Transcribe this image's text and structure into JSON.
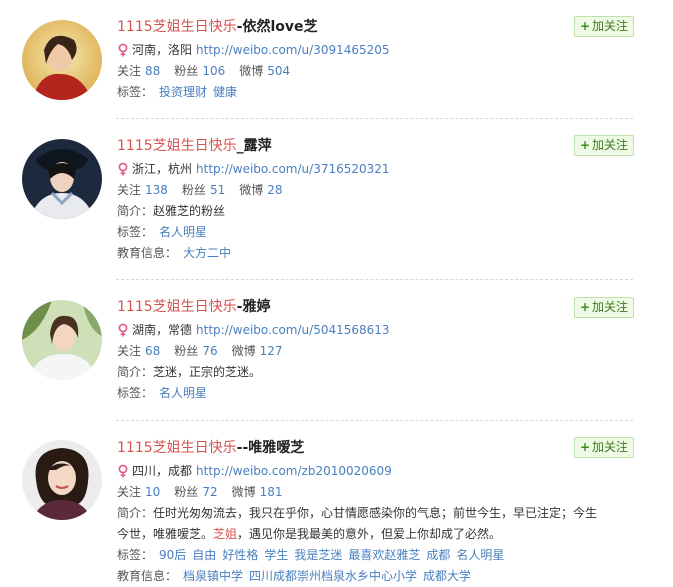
{
  "follow_label": "加关注",
  "users": [
    {
      "name_prefix": "1115芝姐生日快乐",
      "name_suffix": "-依然love芝",
      "location": "河南，洛阳",
      "url": "http://weibo.com/u/3091465205",
      "follow_label": "关注",
      "follow_count": "88",
      "fans_label": "粉丝",
      "fans_count": "106",
      "weibo_label": "微博",
      "weibo_count": "504",
      "tags_label": "标签：",
      "tags": [
        "投资理财",
        "健康"
      ]
    },
    {
      "name_prefix": "1115芝姐生日快乐",
      "name_suffix": "_露萍",
      "location": "浙江，杭州",
      "url": "http://weibo.com/u/3716520321",
      "follow_label": "关注",
      "follow_count": "138",
      "fans_label": "粉丝",
      "fans_count": "51",
      "weibo_label": "微博",
      "weibo_count": "28",
      "intro_label": "简介：",
      "intro": "赵雅芝的粉丝",
      "tags_label": "标签：",
      "tags": [
        "名人明星"
      ],
      "edu_label": "教育信息：",
      "edu": [
        "大方二中"
      ]
    },
    {
      "name_prefix": "1115芝姐生日快乐",
      "name_suffix": "-雅婷",
      "location": "湖南，常德",
      "url": "http://weibo.com/u/5041568613",
      "follow_label": "关注",
      "follow_count": "68",
      "fans_label": "粉丝",
      "fans_count": "76",
      "weibo_label": "微博",
      "weibo_count": "127",
      "intro_label": "简介：",
      "intro": "芝迷，正宗的芝迷。",
      "tags_label": "标签：",
      "tags": [
        "名人明星"
      ]
    },
    {
      "name_prefix": "1115芝姐生日快乐",
      "name_suffix": "--唯雅嗳芝",
      "location": "四川，成都",
      "url": "http://weibo.com/zb2010020609",
      "follow_label": "关注",
      "follow_count": "10",
      "fans_label": "粉丝",
      "fans_count": "72",
      "weibo_label": "微博",
      "weibo_count": "181",
      "intro_label": "简介：",
      "intro_part1": "任时光匆匆流去，我只在乎你，心甘情愿感染你的气息；前世今生，早已注定；今生今世，唯雅嗳芝。",
      "intro_highlight": "芝姐",
      "intro_part2": "，遇见你是我最美的意外，但爱上你却成了必然。",
      "tags_label": "标签：",
      "tags": [
        "90后",
        "自由",
        "好性格",
        "学生",
        "我是芝迷",
        "最喜欢赵雅芝",
        "成都",
        "名人明星"
      ],
      "edu_label": "教育信息：",
      "edu": [
        "档泉镇中学",
        "四川成都崇州档泉水乡中心小学",
        "成都大学"
      ]
    }
  ],
  "colors": {
    "name_red": "#d8534f",
    "link_blue": "#4a7fbf",
    "follow_green": "#3f7a1e"
  }
}
